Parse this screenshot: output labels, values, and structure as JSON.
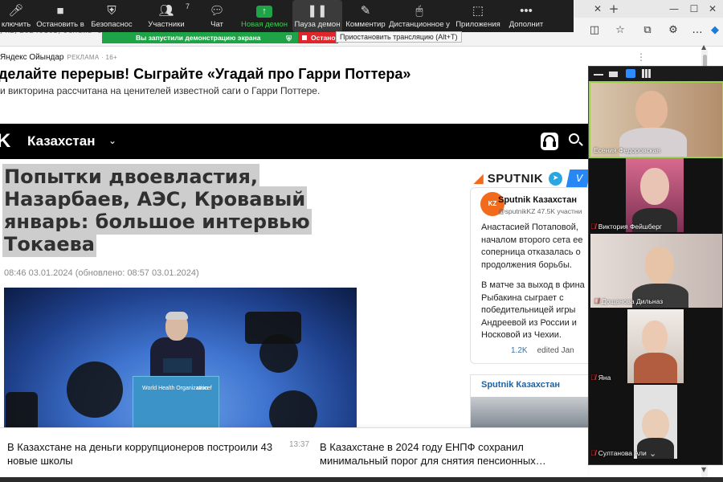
{
  "zoom_toolbar": {
    "items": [
      {
        "id": "unmute",
        "label": "ключить",
        "icon": "microphone-icon"
      },
      {
        "id": "stop_video",
        "label": "Остановить в",
        "icon": "video-camera-icon"
      },
      {
        "id": "security",
        "label": "Безопаснос",
        "icon": "shield-icon"
      },
      {
        "id": "participants",
        "label": "Участники",
        "icon": "participants-icon",
        "count": "7"
      },
      {
        "id": "chat",
        "label": "Чат",
        "icon": "chat-icon"
      },
      {
        "id": "new_share",
        "label": "Новая демон",
        "icon": "share-arrow-icon"
      },
      {
        "id": "pause_share",
        "label": "Пауза демон",
        "icon": "pause-icon"
      },
      {
        "id": "annotate",
        "label": "Комментир",
        "icon": "pencil-icon"
      },
      {
        "id": "remote_control",
        "label": "Дистанционное у",
        "icon": "remote-control-icon"
      },
      {
        "id": "apps",
        "label": "Приложения",
        "icon": "apps-icon"
      },
      {
        "id": "more",
        "label": "Дополнит",
        "icon": "more-dots-icon"
      }
    ],
    "sharing_banner": "Вы запустили демонстрацию экрана",
    "stop_share": "Остано",
    "tooltip": "Приостановить трансляцию (Alt+T)"
  },
  "browser": {
    "url_fragment": "/kz/20240103/ochemu-ckaza",
    "new_tab": "+"
  },
  "ad": {
    "source": "Яндекс Ойындар",
    "tag": "РЕКЛАМА · 16+",
    "title": "делайте перерыв! Сыграйте «Угадай про Гарри Поттера»",
    "desc": "и викторина рассчитана на ценителей известной саги о Гарри Поттере."
  },
  "site": {
    "logo": "K",
    "region": "Казахстан"
  },
  "article": {
    "title_lines": [
      "Попытки двоевластия,",
      "Назарбаев, АЭС, Кровавый",
      "январь: большое интервью",
      "Токаева"
    ],
    "date": "08:46 03.01.2024 (обновлено: 08:57 03.01.2024)",
    "podium_logo_left": "World Health Organization",
    "podium_logo_right": "unicef"
  },
  "sidebar": {
    "brand_prefix": "SPUT",
    "brand_suffix": "NIK",
    "vk_letter": "V",
    "tweet": {
      "name": "Sputnik Казахстан",
      "handle": "@sputnikKZ 47.5K участни",
      "avatar_text": "KZ",
      "lines": [
        "Анастасией Потаповой,",
        "началом второго сета ее",
        "соперница отказалась о",
        "продолжения борьбы.",
        "",
        "В матче за выход в фина",
        "Рыбакина сыграет с",
        "победительницей игры",
        "Андреевой из России и",
        "Носковой из Чехии."
      ],
      "views": "1.2K",
      "edited": "edited  Jan"
    },
    "card_title": "Sputnik Казахстан"
  },
  "bottom_news": {
    "item1": "В Казахстане на деньги коррупционеров построили 43 новые школы",
    "time1": "13:37",
    "item2": "В Казахстане в 2024 году ЕНПФ сохранил минимальный порог для снятия пенсионных…"
  },
  "gallery": {
    "participants": [
      {
        "name": "Есения Федоровская",
        "muted": false
      },
      {
        "name": "Виктория Фейшберг",
        "muted": true
      },
      {
        "name": "Дощанова Дильназ",
        "muted": true
      },
      {
        "name": "Яна",
        "muted": true
      },
      {
        "name": "Султанова Али",
        "muted": true
      }
    ]
  },
  "colors": {
    "zoom_green": "#1ea446",
    "zoom_red": "#e0262b",
    "sputnik_orange": "#f26b1d",
    "sputnik_link": "#1a64a5"
  }
}
